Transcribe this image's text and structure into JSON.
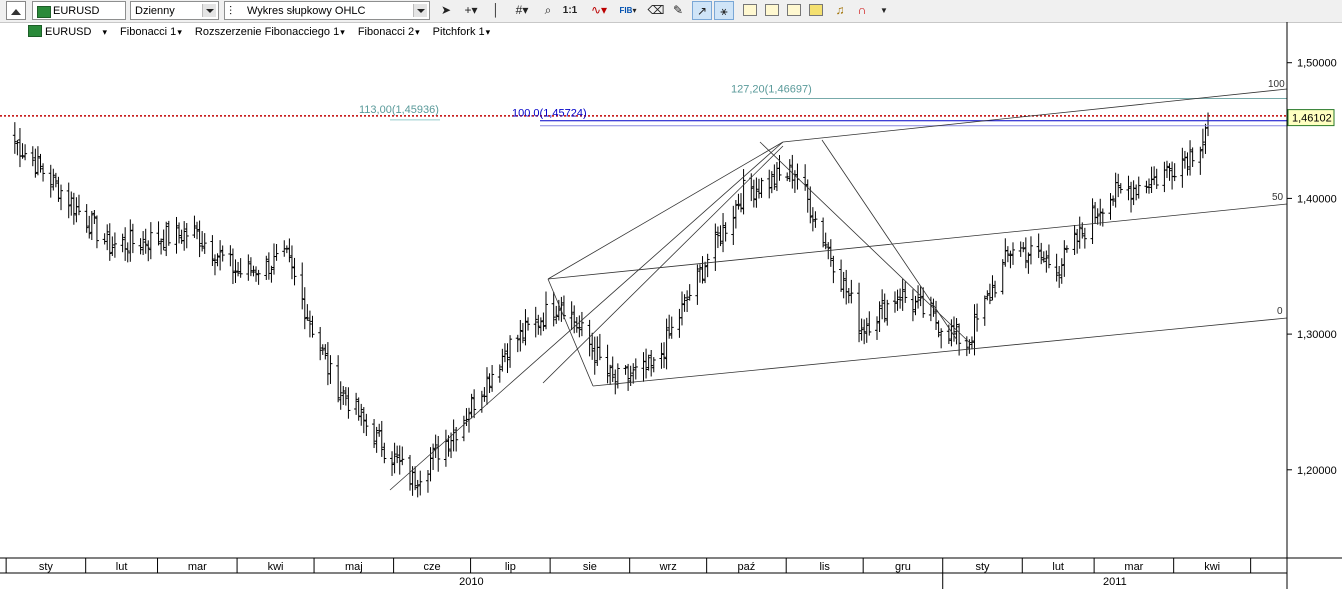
{
  "toolbar": {
    "symbol": "EURUSD",
    "interval": "Dzienny",
    "chart_type": "Wykres słupkowy OHLC",
    "zoom_label": "1:1",
    "fib_label": "FIB"
  },
  "legend": {
    "symbol": "EURUSD",
    "items": [
      "Fibonacci 1",
      "Rozszerzenie Fibonacciego 1",
      "Fibonacci 2",
      "Pitchfork 1"
    ]
  },
  "colors": {
    "price_line": "#c00000",
    "fib_blue": "#0000c8",
    "fib_teal": "#5a9a9a",
    "last_price_bg": "#ffffc0",
    "last_price_border": "#2a7a2a"
  },
  "chart_data": {
    "type": "bar",
    "style": "OHLC",
    "y_axis": {
      "ticks": [
        "1,50000",
        "1,40000",
        "1,30000",
        "1,20000"
      ],
      "tick_values": [
        1.5,
        1.4,
        1.3,
        1.2
      ],
      "ylim": [
        1.135,
        1.53
      ]
    },
    "x_axis": {
      "months": [
        "sty",
        "lut",
        "mar",
        "kwi",
        "maj",
        "cze",
        "lip",
        "sie",
        "wrz",
        "paź",
        "lis",
        "gru",
        "sty",
        "lut",
        "mar",
        "kwi"
      ],
      "years": [
        "2010",
        "2011"
      ]
    },
    "last_price": {
      "label": "1,46102",
      "value": 1.46102
    },
    "horizontal_levels": [
      {
        "label": "113,00(1,45936)",
        "value": 1.45936,
        "style": "dotted-red"
      },
      {
        "label": "100.0(1,45724)",
        "value": 1.45724,
        "style": "blue"
      },
      {
        "label": "127,20(1,46697)",
        "value": 1.46697,
        "style": "teal"
      }
    ],
    "pitchfork_labels": [
      "100",
      "50",
      "0"
    ],
    "series_anchor_closes": [
      {
        "date": "2010-01-04",
        "value": 1.442
      },
      {
        "date": "2010-01-20",
        "value": 1.41
      },
      {
        "date": "2010-02-10",
        "value": 1.365
      },
      {
        "date": "2010-03-15",
        "value": 1.375
      },
      {
        "date": "2010-04-01",
        "value": 1.345
      },
      {
        "date": "2010-04-20",
        "value": 1.355
      },
      {
        "date": "2010-05-07",
        "value": 1.27
      },
      {
        "date": "2010-05-20",
        "value": 1.235
      },
      {
        "date": "2010-06-08",
        "value": 1.192
      },
      {
        "date": "2010-06-25",
        "value": 1.23
      },
      {
        "date": "2010-07-15",
        "value": 1.29
      },
      {
        "date": "2010-08-05",
        "value": 1.325
      },
      {
        "date": "2010-08-25",
        "value": 1.265
      },
      {
        "date": "2010-09-10",
        "value": 1.275
      },
      {
        "date": "2010-09-28",
        "value": 1.345
      },
      {
        "date": "2010-10-15",
        "value": 1.405
      },
      {
        "date": "2010-11-04",
        "value": 1.42
      },
      {
        "date": "2010-11-20",
        "value": 1.35
      },
      {
        "date": "2010-11-30",
        "value": 1.305
      },
      {
        "date": "2010-12-15",
        "value": 1.33
      },
      {
        "date": "2011-01-10",
        "value": 1.293
      },
      {
        "date": "2011-01-28",
        "value": 1.365
      },
      {
        "date": "2011-02-15",
        "value": 1.35
      },
      {
        "date": "2011-03-05",
        "value": 1.4
      },
      {
        "date": "2011-03-25",
        "value": 1.415
      },
      {
        "date": "2011-04-08",
        "value": 1.435
      },
      {
        "date": "2011-04-12",
        "value": 1.445
      },
      {
        "date": "2011-04-14",
        "value": 1.461
      }
    ]
  }
}
